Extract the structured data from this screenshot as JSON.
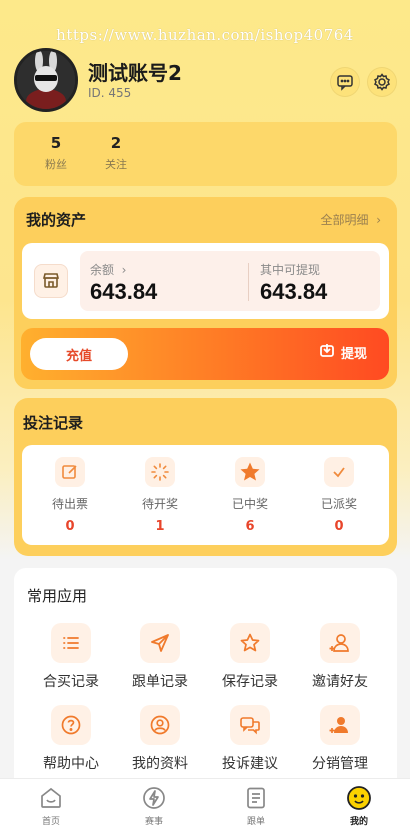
{
  "watermark": "https://www.huzhan.com/ishop40764",
  "profile": {
    "name": "测试账号2",
    "id_text": "ID. 455"
  },
  "header_icons": [
    "message-icon",
    "gear-icon"
  ],
  "stats": [
    {
      "value": "5",
      "label": "粉丝"
    },
    {
      "value": "2",
      "label": "关注"
    }
  ],
  "assets": {
    "title": "我的资产",
    "detail_link": "全部明细",
    "balance_label": "余额",
    "balance_value": "643.84",
    "withdrawable_label": "其中可提现",
    "withdrawable_value": "643.84",
    "recharge_label": "充值",
    "withdraw_label": "提现"
  },
  "bets": {
    "title": "投注记录",
    "items": [
      {
        "label": "待出票",
        "count": "0",
        "icon": "edit-icon"
      },
      {
        "label": "待开奖",
        "count": "1",
        "icon": "loading-icon"
      },
      {
        "label": "已中奖",
        "count": "6",
        "icon": "star-icon"
      },
      {
        "label": "已派奖",
        "count": "0",
        "icon": "check-icon"
      }
    ]
  },
  "apps": {
    "title": "常用应用",
    "items": [
      {
        "label": "合买记录",
        "icon": "list-icon"
      },
      {
        "label": "跟单记录",
        "icon": "send-icon"
      },
      {
        "label": "保存记录",
        "icon": "star-outline-icon"
      },
      {
        "label": "邀请好友",
        "icon": "add-user-icon"
      },
      {
        "label": "帮助中心",
        "icon": "help-icon"
      },
      {
        "label": "我的资料",
        "icon": "profile-icon"
      },
      {
        "label": "投诉建议",
        "icon": "chat-icon"
      },
      {
        "label": "分销管理",
        "icon": "distribution-icon"
      }
    ]
  },
  "tabbar": [
    {
      "label": "首页",
      "icon": "home-icon"
    },
    {
      "label": "赛事",
      "icon": "lightning-icon"
    },
    {
      "label": "跟单",
      "icon": "document-icon"
    },
    {
      "label": "我的",
      "icon": "mine-icon",
      "active": true
    }
  ],
  "colors": {
    "accent": "#ff6a28",
    "highlight": "#fdcf5c",
    "count": "#e8452b"
  }
}
